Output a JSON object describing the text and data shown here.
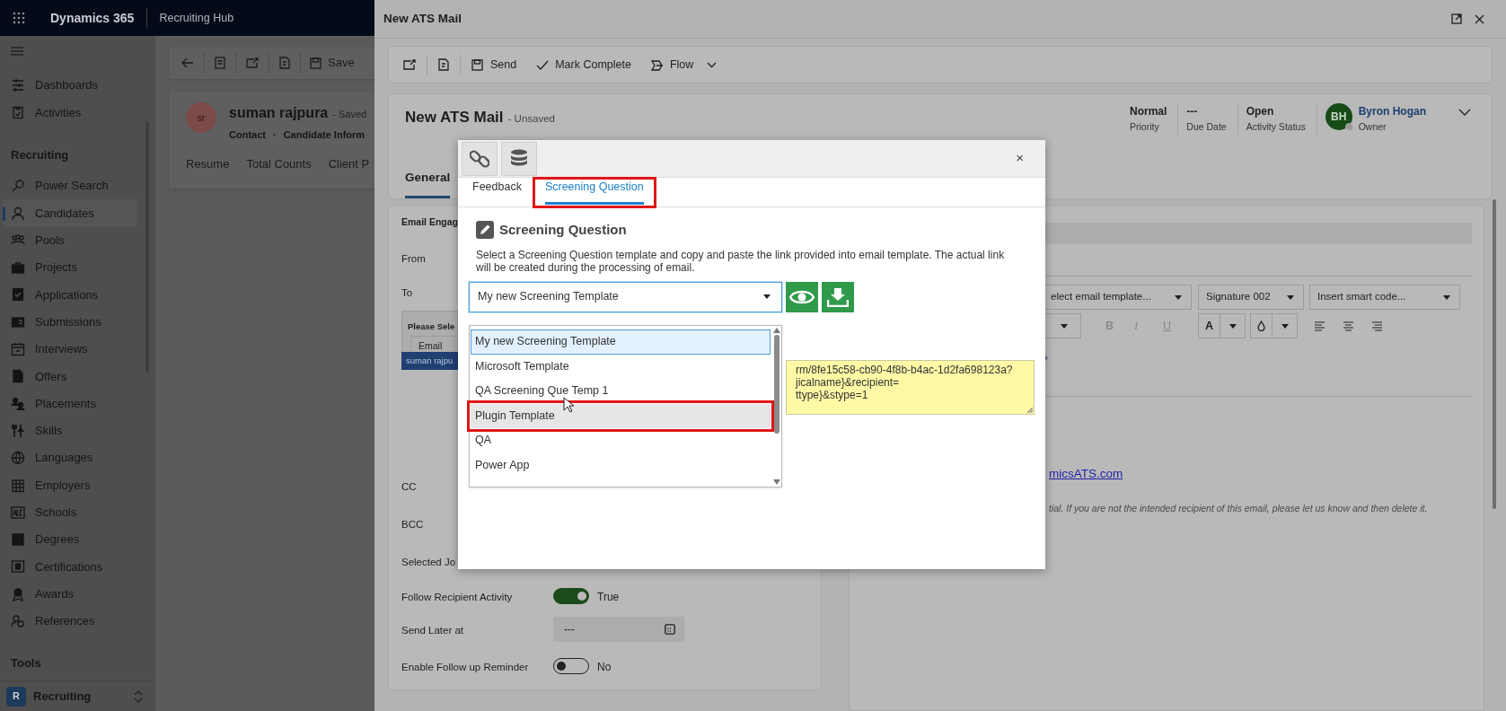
{
  "app_bar": {
    "title": "Dynamics 365",
    "area": "Recruiting Hub"
  },
  "sidebar": {
    "top_items": [
      {
        "label": "Dashboards",
        "selected": false
      },
      {
        "label": "Activities",
        "selected": false
      }
    ],
    "section_heading": "Recruiting",
    "items": [
      {
        "label": "Power Search",
        "selected": false
      },
      {
        "label": "Candidates",
        "selected": true
      },
      {
        "label": "Pools",
        "selected": false
      },
      {
        "label": "Projects",
        "selected": false
      },
      {
        "label": "Applications",
        "selected": false
      },
      {
        "label": "Submissions",
        "selected": false
      },
      {
        "label": "Interviews",
        "selected": false
      },
      {
        "label": "Offers",
        "selected": false
      },
      {
        "label": "Placements",
        "selected": false
      },
      {
        "label": "Skills",
        "selected": false
      },
      {
        "label": "Languages",
        "selected": false
      },
      {
        "label": "Employers",
        "selected": false
      },
      {
        "label": "Schools",
        "selected": false
      },
      {
        "label": "Degrees",
        "selected": false
      },
      {
        "label": "Certifications",
        "selected": false
      },
      {
        "label": "Awards",
        "selected": false
      },
      {
        "label": "References",
        "selected": false
      }
    ],
    "tools_heading": "Tools",
    "area_badge": "R",
    "area_label": "Recruiting"
  },
  "record": {
    "save_label": "Save",
    "avatar": "sr",
    "name": "suman rajpura",
    "status": "- Saved",
    "entity": "Contact",
    "separator": "·",
    "form": "Candidate Inform",
    "tabs": [
      "Resume",
      "Total Counts",
      "Client P"
    ]
  },
  "mail_panel": {
    "title": "New ATS Mail",
    "toolbar": [
      {
        "label": "Send"
      },
      {
        "label": "Mark Complete"
      },
      {
        "label": "Flow"
      }
    ],
    "header": {
      "title": "New ATS Mail",
      "status": "- Unsaved",
      "fields": [
        {
          "value": "Normal",
          "label": "Priority"
        },
        {
          "value": "---",
          "label": "Due Date"
        },
        {
          "value": "Open",
          "label": "Activity Status"
        }
      ],
      "owner": {
        "initials": "BH",
        "name": "Byron Hogan",
        "label": "Owner"
      }
    },
    "tabs": [
      {
        "label": "General",
        "selected": true
      }
    ],
    "engagement": {
      "heading": "Email Engag",
      "from_label": "From",
      "to_label": "To",
      "recipient_title": "Please Sele",
      "recipient_type": "Email",
      "recipient_chip": "suman rajpu",
      "cc_label": "CC",
      "bcc_label": "BCC",
      "job_label": "Selected Jo",
      "rows": [
        {
          "kind": "switch",
          "label": "Follow Recipient Activity",
          "on": true,
          "value": "True"
        },
        {
          "kind": "date",
          "label": "Send Later at",
          "value": "---"
        },
        {
          "kind": "switch",
          "label": "Enable Follow up Reminder",
          "on": false,
          "value": "No"
        }
      ]
    },
    "editor": {
      "selects": [
        "elect email template...",
        "Signature 002",
        "Insert smart code..."
      ],
      "format_buttons": [
        "B",
        "I",
        "U"
      ],
      "font_color": "A",
      "link": "micsATS.com",
      "disclaimer": "tial. If you are not the intended recipient of this email, please let us know and then delete it."
    }
  },
  "dialog": {
    "close": "×",
    "tabs": [
      {
        "label": "Feedback",
        "selected": false,
        "highlighted": false
      },
      {
        "label": "Screening Question",
        "selected": true,
        "highlighted": true
      }
    ],
    "heading": "Screening Question",
    "description": "Select a Screening Question template and copy and paste the link provided into email template. The actual link will be created during the processing of email.",
    "select": {
      "value": "My new Screening Template",
      "expanded": true
    },
    "options": [
      {
        "label": "My new Screening Template",
        "selected": true,
        "hovered": false,
        "highlighted": false
      },
      {
        "label": "Microsoft Template",
        "selected": false,
        "hovered": false,
        "highlighted": false
      },
      {
        "label": "QA Screening Que Temp 1",
        "selected": false,
        "hovered": false,
        "highlighted": false
      },
      {
        "label": "Plugin Template",
        "selected": false,
        "hovered": true,
        "highlighted": true
      },
      {
        "label": "QA",
        "selected": false,
        "hovered": false,
        "highlighted": false
      },
      {
        "label": "Power App",
        "selected": false,
        "hovered": false,
        "highlighted": false
      }
    ],
    "link_lines": [
      "rm/8fe15c58-cb90-4f8b-b4ac-1d2fa698123a?",
      "jicalname}&recipient=",
      "ttype}&stype=1"
    ]
  }
}
